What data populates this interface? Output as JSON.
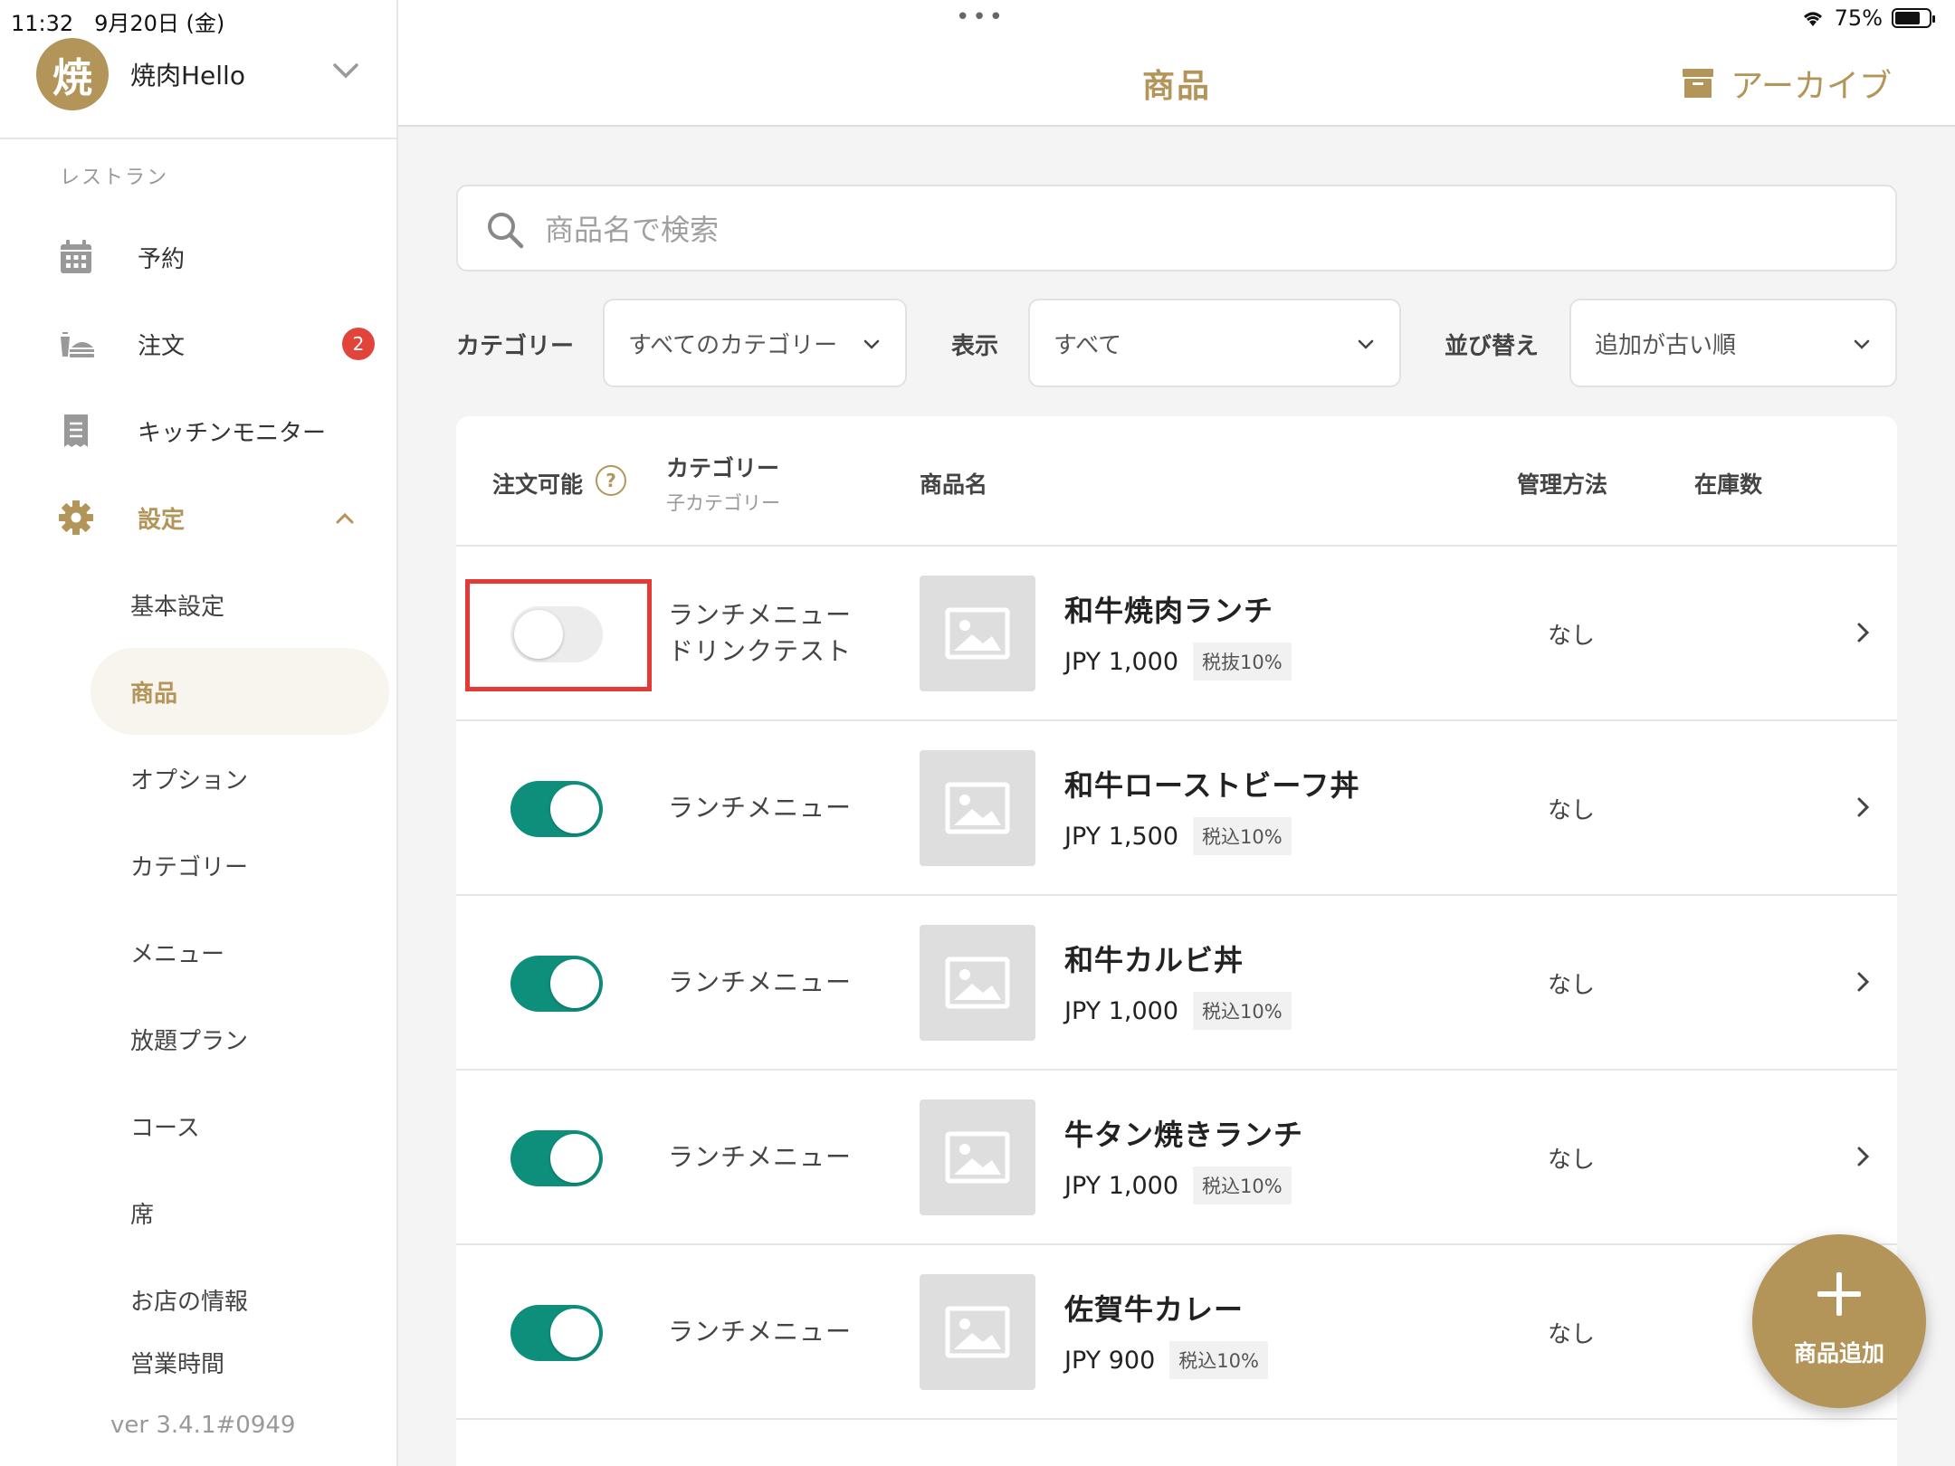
{
  "status_bar": {
    "time": "11:32",
    "date": "9月20日 (金)",
    "battery": "75%",
    "battery_level": 0.75
  },
  "account": {
    "avatar_letter": "焼",
    "name": "焼肉Hello"
  },
  "sidebar": {
    "section_label": "レストラン",
    "items": [
      {
        "label": "予約",
        "icon": "calendar-icon"
      },
      {
        "label": "注文",
        "icon": "order-icon",
        "badge": "2"
      },
      {
        "label": "キッチンモニター",
        "icon": "receipt-icon"
      },
      {
        "label": "設定",
        "icon": "gear-icon",
        "active": true
      }
    ],
    "sub_items": [
      {
        "label": "基本設定"
      },
      {
        "label": "商品",
        "active": true
      },
      {
        "label": "オプション"
      },
      {
        "label": "カテゴリー"
      },
      {
        "label": "メニュー"
      },
      {
        "label": "放題プラン"
      },
      {
        "label": "コース"
      },
      {
        "label": "席"
      },
      {
        "label": "お店の情報"
      },
      {
        "label": "営業時間"
      }
    ],
    "version": "ver 3.4.1#0949"
  },
  "header": {
    "title": "商品",
    "archive_label": "アーカイブ"
  },
  "search": {
    "placeholder": "商品名で検索",
    "value": ""
  },
  "filters": {
    "category_label": "カテゴリー",
    "category_value": "すべてのカテゴリー",
    "display_label": "表示",
    "display_value": "すべて",
    "sort_label": "並び替え",
    "sort_value": "追加が古い順"
  },
  "table": {
    "headers": {
      "available": "注文可能",
      "category": "カテゴリー",
      "subcategory": "子カテゴリー",
      "name": "商品名",
      "management": "管理方法",
      "stock": "在庫数"
    },
    "rows": [
      {
        "available": false,
        "category_line1": "ランチメニュー",
        "category_line2": "ドリンクテスト",
        "name": "和牛焼肉ランチ",
        "price": "JPY 1,000",
        "tax": "税抜10%",
        "management": "なし"
      },
      {
        "available": true,
        "category_line1": "ランチメニュー",
        "category_line2": "",
        "name": "和牛ローストビーフ丼",
        "price": "JPY 1,500",
        "tax": "税込10%",
        "management": "なし"
      },
      {
        "available": true,
        "category_line1": "ランチメニュー",
        "category_line2": "",
        "name": "和牛カルビ丼",
        "price": "JPY 1,000",
        "tax": "税込10%",
        "management": "なし"
      },
      {
        "available": true,
        "category_line1": "ランチメニュー",
        "category_line2": "",
        "name": "牛タン焼きランチ",
        "price": "JPY 1,000",
        "tax": "税込10%",
        "management": "なし"
      },
      {
        "available": true,
        "category_line1": "ランチメニュー",
        "category_line2": "",
        "name": "佐賀牛カレー",
        "price": "JPY 900",
        "tax": "税込10%",
        "management": "なし"
      }
    ]
  },
  "fab": {
    "label": "商品追加"
  },
  "colors": {
    "accent": "#b3955a",
    "toggle_on": "#0e8f7c",
    "badge": "#e0443a",
    "highlight": "#e53935"
  }
}
